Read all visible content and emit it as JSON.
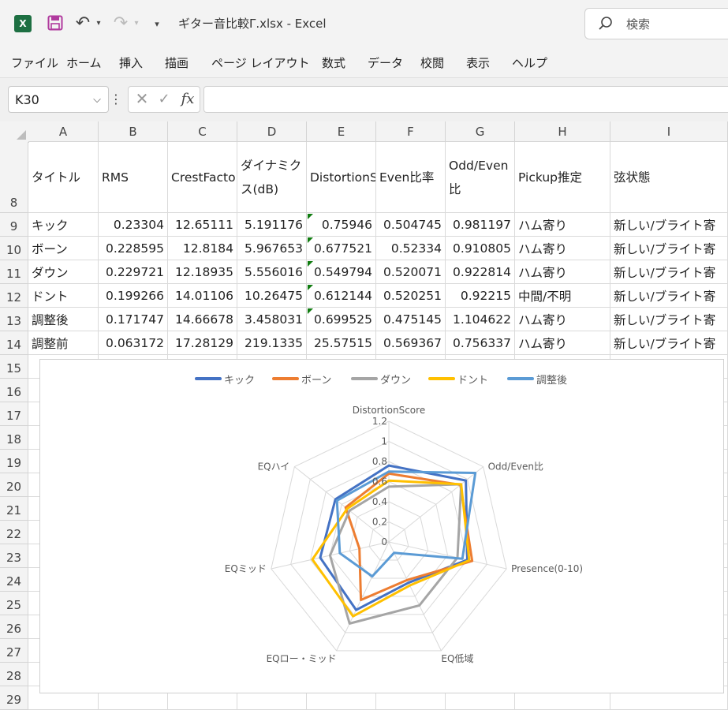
{
  "titlebar": {
    "app_icon_letter": "X",
    "doc_title": "ギター音比較Γ.xlsx  -  Excel",
    "search_placeholder": "検索"
  },
  "menu": [
    "ファイル",
    "ホーム",
    "挿入",
    "描画",
    "ページ レイアウト",
    "数式",
    "データ",
    "校閲",
    "表示",
    "ヘルプ"
  ],
  "formula_bar": {
    "name_box": "K30",
    "fx_label": "fx",
    "formula": ""
  },
  "columns": [
    "A",
    "B",
    "C",
    "D",
    "E",
    "F",
    "G",
    "H",
    "I"
  ],
  "rows": [
    "8",
    "9",
    "10",
    "11",
    "12",
    "13",
    "14",
    "15",
    "16",
    "17",
    "18",
    "19",
    "20",
    "21",
    "22",
    "23",
    "24",
    "25",
    "26",
    "27",
    "28",
    "29"
  ],
  "table": {
    "headers": [
      "タイトル",
      "RMS",
      "CrestFactor(dB)",
      "ダイナミクス(dB)",
      "DistortionScore",
      "Even比率",
      "Odd/Even比",
      "Pickup推定",
      "弦状態"
    ],
    "rows": [
      [
        "キック",
        "0.23304",
        "12.65111",
        "5.191176",
        "0.75946",
        "0.504745",
        "0.981197",
        "ハム寄り",
        "新しい/ブライト寄"
      ],
      [
        "ボーン",
        "0.228595",
        "12.8184",
        "5.967653",
        "0.677521",
        "0.52334",
        "0.910805",
        "ハム寄り",
        "新しい/ブライト寄"
      ],
      [
        "ダウン",
        "0.229721",
        "12.18935",
        "5.556016",
        "0.549794",
        "0.520071",
        "0.922814",
        "ハム寄り",
        "新しい/ブライト寄"
      ],
      [
        "ドント",
        "0.199266",
        "14.01106",
        "10.26475",
        "0.612144",
        "0.520251",
        "0.92215",
        "中間/不明",
        "新しい/ブライト寄"
      ],
      [
        "調整後",
        "0.171747",
        "14.66678",
        "3.458031",
        "0.699525",
        "0.475145",
        "1.104622",
        "ハム寄り",
        "新しい/ブライト寄"
      ],
      [
        "調整前",
        "0.063172",
        "17.28129",
        "219.1335",
        "25.57515",
        "0.569367",
        "0.756337",
        "ハム寄り",
        "新しい/ブライト寄"
      ]
    ]
  },
  "chart_data": {
    "type": "radar",
    "title": "",
    "axes": [
      "DistortionScore",
      "Odd/Even比",
      "Presence(0-10)",
      "EQ低域",
      "EQロー・ミッド",
      "EQミッド",
      "EQハイ"
    ],
    "ticks": [
      "0",
      "0.2",
      "0.4",
      "0.6",
      "0.8",
      "1",
      "1.2"
    ],
    "rmax": 1.2,
    "grid": true,
    "legend_position": "top",
    "series": [
      {
        "name": "キック",
        "color": "#4472c4",
        "values": [
          0.76,
          0.98,
          0.8,
          0.45,
          0.75,
          0.7,
          0.68
        ]
      },
      {
        "name": "ボーン",
        "color": "#ed7d31",
        "values": [
          0.68,
          0.91,
          0.85,
          0.42,
          0.64,
          0.3,
          0.55
        ]
      },
      {
        "name": "ダウン",
        "color": "#a5a5a5",
        "values": [
          0.55,
          0.92,
          0.7,
          0.7,
          0.9,
          0.6,
          0.5
        ]
      },
      {
        "name": "ドント",
        "color": "#ffc000",
        "values": [
          0.61,
          0.92,
          0.82,
          0.48,
          0.82,
          0.78,
          0.53
        ]
      },
      {
        "name": "調整後",
        "color": "#5b9bd5",
        "values": [
          0.7,
          1.1,
          0.75,
          0.12,
          0.38,
          0.5,
          0.66
        ]
      }
    ]
  }
}
